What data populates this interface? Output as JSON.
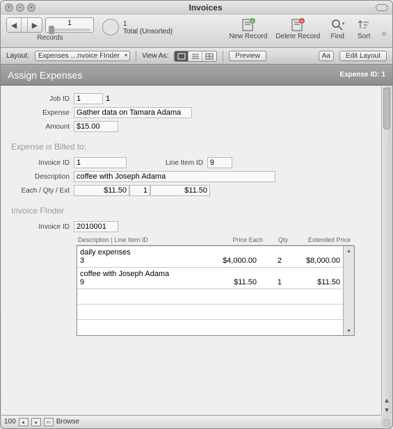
{
  "window": {
    "title": "Invoices"
  },
  "toolbar": {
    "record_index": "1",
    "record_count": "1",
    "record_status": "Total (Unsorted)",
    "records_label": "Records",
    "new_record": "New Record",
    "delete_record": "Delete Record",
    "find": "Find",
    "sort": "Sort"
  },
  "layoutbar": {
    "label": "Layout:",
    "layout_name": "Expenses …nvoice FInder",
    "view_as": "View As:",
    "preview": "Preview",
    "aa": "Aa",
    "edit_layout": "Edit Layout"
  },
  "header": {
    "title": "Assign Expenses",
    "expense_id_label": "Expense ID:",
    "expense_id_value": "1"
  },
  "fields": {
    "job_id_label": "Job ID",
    "job_id_value": "1",
    "job_id_extra": "1",
    "expense_label": "Expense",
    "expense_value": "Gather data on Tamara Adama",
    "amount_label": "Amount",
    "amount_value": "$15.00"
  },
  "billed": {
    "section": "Expense is Billed to:",
    "invoice_id_label": "Invoice ID",
    "invoice_id_value": "1",
    "line_item_id_label": "Line Item ID",
    "line_item_id_value": "9",
    "description_label": "Description",
    "description_value": "coffee with Joseph Adama",
    "eqe_label": "Each / Qty / Ext",
    "each": "$11.50",
    "qty": "1",
    "ext": "$11.50"
  },
  "finder": {
    "section": "Invoice FInder",
    "invoice_id_label": "Invoice ID",
    "invoice_id_value": "2010001",
    "col_desc": "Description | Line Item ID",
    "col_price": "Price Each",
    "col_qty": "Qty",
    "col_ext": "Extended Price",
    "rows": [
      {
        "desc": "daily expenses",
        "line": "3",
        "price": "$4,000.00",
        "qty": "2",
        "ext": "$8,000.00"
      },
      {
        "desc": "coffee with Joseph Adama",
        "line": "9",
        "price": "$11.50",
        "qty": "1",
        "ext": "$11.50"
      }
    ]
  },
  "status": {
    "zoom": "100",
    "mode": "Browse"
  }
}
